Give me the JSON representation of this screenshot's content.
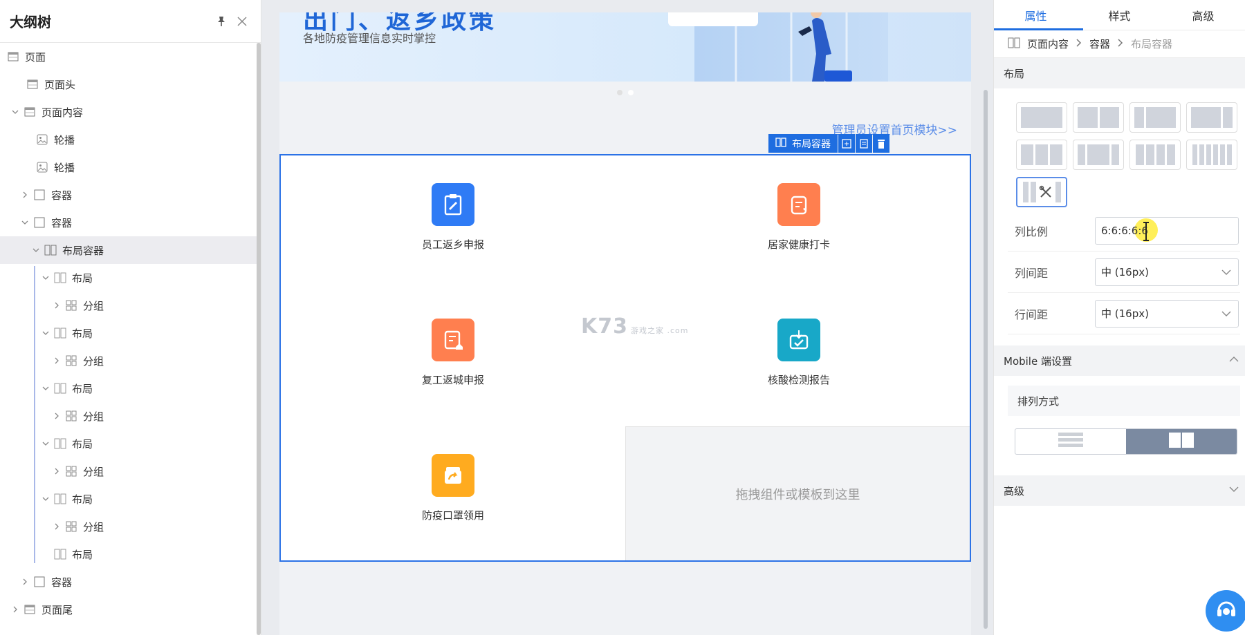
{
  "outline": {
    "title": "大纲树",
    "nodes": [
      {
        "label": "页面"
      },
      {
        "label": "页面头"
      },
      {
        "label": "页面内容"
      },
      {
        "label": "轮播"
      },
      {
        "label": "轮播"
      },
      {
        "label": "容器"
      },
      {
        "label": "容器"
      },
      {
        "label": "布局容器"
      },
      {
        "label": "布局"
      },
      {
        "label": "分组"
      },
      {
        "label": "布局"
      },
      {
        "label": "分组"
      },
      {
        "label": "布局"
      },
      {
        "label": "分组"
      },
      {
        "label": "布局"
      },
      {
        "label": "分组"
      },
      {
        "label": "布局"
      },
      {
        "label": "分组"
      },
      {
        "label": "布局"
      },
      {
        "label": "容器"
      },
      {
        "label": "页面尾"
      }
    ]
  },
  "canvas": {
    "banner_title": "出门、返乡政策",
    "banner_subtitle": "各地防疫管理信息实时掌控",
    "admin_link": "管理员设置首页模块>>",
    "selected_component_label": "布局容器",
    "items": [
      {
        "label": "员工返乡申报",
        "color": "#2f7bf5"
      },
      {
        "label": "居家健康打卡",
        "color": "#ff7f4f"
      },
      {
        "label": "复工返城申报",
        "color": "#ff7f4f"
      },
      {
        "label": "核酸检测报告",
        "color": "#18a8c8"
      },
      {
        "label": "防疫口罩领用",
        "color": "#ffab1f"
      }
    ],
    "drop_hint": "拖拽组件或模板到这里",
    "watermark": "K73",
    "watermark_sub": "游戏之家 .com"
  },
  "props": {
    "tabs": [
      "属性",
      "样式",
      "高级"
    ],
    "breadcrumb": [
      "页面内容",
      "容器",
      "布局容器"
    ],
    "layout_section": "布局",
    "fields": {
      "col_ratio_label": "列比例",
      "col_ratio_value": "6:6:6:6:6",
      "col_gap_label": "列间距",
      "col_gap_value": "中 (16px)",
      "row_gap_label": "行间距",
      "row_gap_value": "中 (16px)"
    },
    "mobile_section": "Mobile 端设置",
    "arrange_label": "排列方式",
    "advanced_section": "高级"
  },
  "colors": {
    "accent": "#1e6de0",
    "selection_border": "#2b72e6"
  }
}
